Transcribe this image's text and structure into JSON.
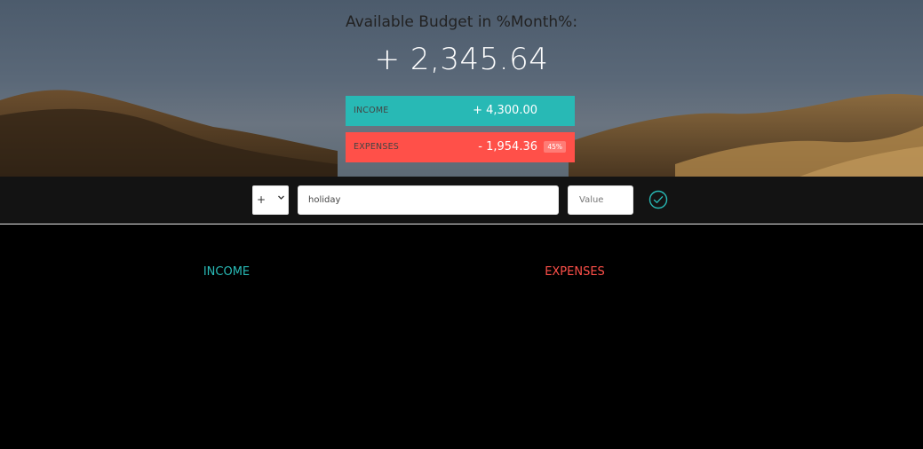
{
  "header": {
    "title": "Available Budget in %Month%:",
    "budget_value": "+ 2,345.64"
  },
  "summary": {
    "income_label": "INCOME",
    "income_value": "+ 4,300.00",
    "expenses_label": "EXPENSES",
    "expenses_value": "- 1,954.36",
    "expenses_percentage": "45%"
  },
  "add_form": {
    "type_value": "+",
    "description_value": "holiday",
    "value_placeholder": "Value"
  },
  "lists": {
    "income_title": "INCOME",
    "expenses_title": "EXPENSES"
  },
  "colors": {
    "income": "#28b9b5",
    "expenses": "#ff5049",
    "bar_background": "#131313"
  },
  "icons": {
    "add_button": "check-circle-icon",
    "select_arrow": "chevron-down-icon"
  }
}
